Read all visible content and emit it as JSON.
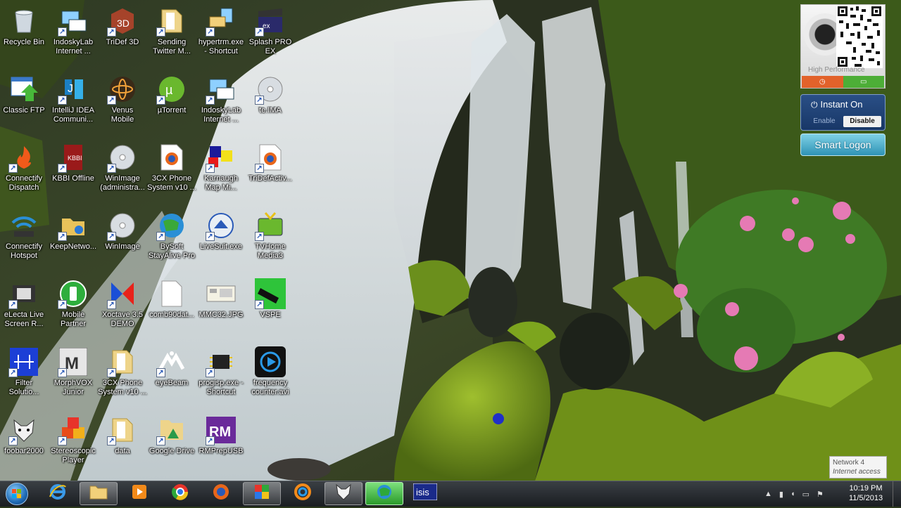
{
  "desktop": {
    "icons": [
      {
        "label": "Recycle Bin",
        "icon": "recycle-bin-icon",
        "shortcut": false
      },
      {
        "label": "Classic FTP",
        "icon": "ftp-icon",
        "shortcut": false
      },
      {
        "label": "Connectify\nDispatch",
        "icon": "connectify-dispatch-icon",
        "shortcut": true
      },
      {
        "label": "Connectify\nHotspot",
        "icon": "wifi-hotspot-icon",
        "shortcut": false
      },
      {
        "label": "eLecta Live\nScreen R...",
        "icon": "film-icon",
        "shortcut": true
      },
      {
        "label": "Filter\nSolutio...",
        "icon": "filter-circuit-icon",
        "shortcut": true
      },
      {
        "label": "foobar2000",
        "icon": "foobar-icon",
        "shortcut": true
      },
      {
        "label": "IndoskyLab\nInternet ...",
        "icon": "network-computer-icon",
        "shortcut": true
      },
      {
        "label": "IntelliJ IDEA\nCommuni...",
        "icon": "intellij-icon",
        "shortcut": true
      },
      {
        "label": "KBBI Offline",
        "icon": "book-icon",
        "shortcut": true
      },
      {
        "label": "KeepNetwo...",
        "icon": "network-folder-icon",
        "shortcut": true
      },
      {
        "label": "Mobile\nPartner",
        "icon": "mobile-partner-icon",
        "shortcut": true
      },
      {
        "label": "MorphVOX\nJunior",
        "icon": "morphvox-icon",
        "shortcut": true
      },
      {
        "label": "Stereoscopic\nPlayer",
        "icon": "cubes-icon",
        "shortcut": true
      },
      {
        "label": "TriDef 3D",
        "icon": "tridef-cube-icon",
        "shortcut": true
      },
      {
        "label": "Venus\nMobile",
        "icon": "atom-icon",
        "shortcut": true
      },
      {
        "label": "WinImage\n(administra...",
        "icon": "disc-icon",
        "shortcut": true
      },
      {
        "label": "WinImage",
        "icon": "disc-icon",
        "shortcut": true
      },
      {
        "label": "Xoctave 3.5\nDEMO",
        "icon": "xoctave-icon",
        "shortcut": true
      },
      {
        "label": "3CX Phone\nSystem v10 ...",
        "icon": "folder-icon",
        "shortcut": true
      },
      {
        "label": "data",
        "icon": "folder-icon",
        "shortcut": true
      },
      {
        "label": "Sending\nTwitter M...",
        "icon": "folder-icon",
        "shortcut": true
      },
      {
        "label": "µTorrent",
        "icon": "utorrent-icon",
        "shortcut": true
      },
      {
        "label": "3CX Phone\nSystem v10 ...",
        "icon": "firefox-doc-icon",
        "shortcut": false
      },
      {
        "label": "BySoft\nStayAlive Pro",
        "icon": "globe-phone-icon",
        "shortcut": true
      },
      {
        "label": "comb90dat...",
        "icon": "blank-file-icon",
        "shortcut": false
      },
      {
        "label": "eyeBeam",
        "icon": "eyebeam-icon",
        "shortcut": true
      },
      {
        "label": "Google Drive",
        "icon": "google-drive-folder-icon",
        "shortcut": true
      },
      {
        "label": "hypertrm.exe\n- Shortcut",
        "icon": "hyperterminal-icon",
        "shortcut": true
      },
      {
        "label": "IndoskyLab\nInternet ...",
        "icon": "network-computer-icon",
        "shortcut": true
      },
      {
        "label": "Karnaugh\nMap Mi...",
        "icon": "karnaugh-icon",
        "shortcut": true
      },
      {
        "label": "LiveSuit.exe",
        "icon": "livesuit-icon",
        "shortcut": true
      },
      {
        "label": "MMC32.JPG",
        "icon": "image-file-icon",
        "shortcut": false
      },
      {
        "label": "progisp.exe -\nShortcut",
        "icon": "chip-icon",
        "shortcut": true
      },
      {
        "label": "RMPrepUSB",
        "icon": "rm-icon",
        "shortcut": true
      },
      {
        "label": "Splash PRO\nEX",
        "icon": "clapper-icon",
        "shortcut": true
      },
      {
        "label": "te.IMA",
        "icon": "disc-icon",
        "shortcut": true
      },
      {
        "label": "TriDefActiv...",
        "icon": "firefox-doc-icon",
        "shortcut": true
      },
      {
        "label": "TVHome\nMedia3",
        "icon": "tv-icon",
        "shortcut": true
      },
      {
        "label": "VSPE",
        "icon": "vspe-icon",
        "shortcut": true
      },
      {
        "label": "frequency\ncounter.avi",
        "icon": "video-play-icon",
        "shortcut": false
      }
    ]
  },
  "widget": {
    "perf_label": "High Performance",
    "instant_title": "Instant On",
    "enable": "Enable",
    "disable": "Disable",
    "smart_logon": "Smart Logon"
  },
  "tooltip": {
    "line1": "Network  4",
    "line2": "Internet access"
  },
  "taskbar": {
    "pinned": [
      {
        "name": "internet-explorer-icon",
        "active": false
      },
      {
        "name": "windows-explorer-icon",
        "active": true
      },
      {
        "name": "media-player-icon",
        "active": false
      },
      {
        "name": "chrome-icon",
        "active": false
      },
      {
        "name": "firefox-icon",
        "active": false
      },
      {
        "name": "colored-squares-icon",
        "active": true
      },
      {
        "name": "sync-circle-icon",
        "active": false
      },
      {
        "name": "fox-mask-icon",
        "active": true
      },
      {
        "name": "globe-app-icon",
        "active": true,
        "green": true
      },
      {
        "name": "isis-icon",
        "active": false,
        "text": "isis"
      }
    ],
    "time": "10:19 PM",
    "date": "11/5/2013"
  },
  "colors": {
    "taskbar": "#1a1d21",
    "moss": "#6d8b1f",
    "water": "#e8eef2",
    "flower": "#e57ab4"
  }
}
